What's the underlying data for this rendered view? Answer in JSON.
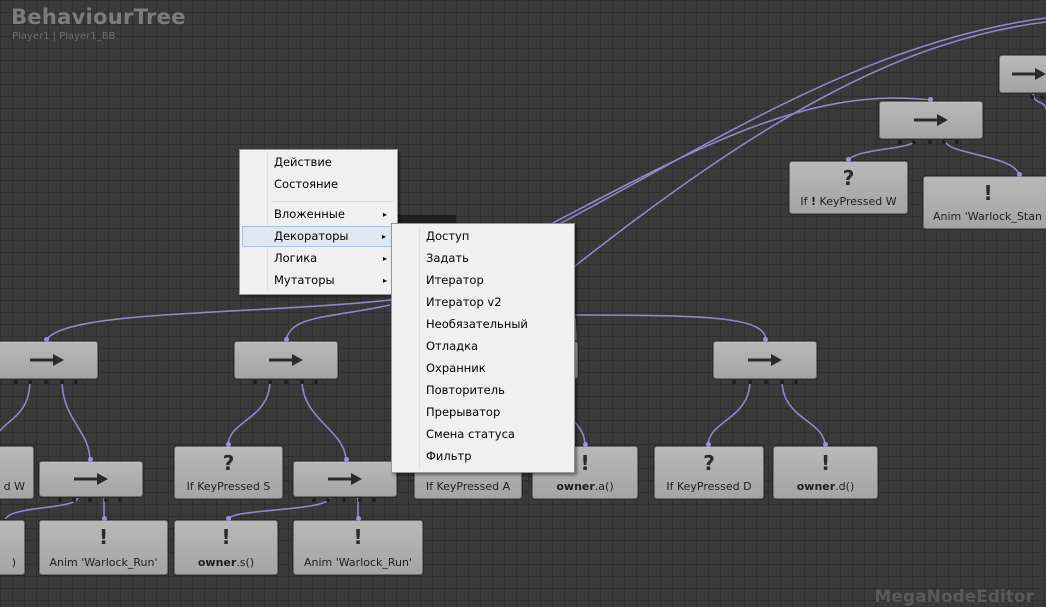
{
  "header": {
    "title": "BehaviourTree",
    "subtitle": "Player1 | Player1_BB"
  },
  "watermark": "MegaNodeEditor",
  "colors": {
    "wire": "#8f87c9",
    "node": "#adadad",
    "background": "#3a3a3a"
  },
  "nodes": {
    "seq_top_right": {
      "icon": "arrow-right-icon"
    },
    "seq_right": {
      "icon": "arrow-right-icon"
    },
    "if_w_right": {
      "glyph": "?",
      "label_prefix": "If ",
      "label_bang": "!",
      "label_rest": " KeyPressed W"
    },
    "anim_stand": {
      "glyph": "!",
      "label": "Anim 'Warlock_Stan"
    },
    "seq_1": {
      "icon": "arrow-right-icon"
    },
    "seq_2": {
      "icon": "arrow-right-icon"
    },
    "seq_4": {
      "icon": "arrow-right-icon"
    },
    "seq_run_left": {
      "icon": "arrow-right-icon"
    },
    "seq_run_mid": {
      "icon": "arrow-right-icon"
    },
    "left_w": {
      "label": "d W"
    },
    "left_paren": {
      "label": ")"
    },
    "anim_run_left": {
      "glyph": "!",
      "label": "Anim 'Warlock_Run'"
    },
    "if_s": {
      "glyph": "?",
      "label": "If KeyPressed S"
    },
    "owner_s": {
      "glyph": "!",
      "label_bold": "owner",
      "label_rest": ".s()"
    },
    "anim_run_mid": {
      "glyph": "!",
      "label": "Anim 'Warlock_Run'"
    },
    "if_a": {
      "label": "If KeyPressed A"
    },
    "owner_a": {
      "glyph": "!",
      "label_bold": "owner",
      "label_rest": ".a()"
    },
    "if_d": {
      "glyph": "?",
      "label": "If KeyPressed D"
    },
    "owner_d": {
      "glyph": "!",
      "label_bold": "owner",
      "label_rest": ".d()"
    }
  },
  "context_menu": {
    "items": [
      {
        "label": "Действие",
        "submenu": false
      },
      {
        "label": "Состояние",
        "submenu": false
      },
      {
        "label": "Вложенные",
        "submenu": true
      },
      {
        "label": "Декораторы",
        "submenu": true,
        "highlighted": true
      },
      {
        "label": "Логика",
        "submenu": true
      },
      {
        "label": "Мутаторы",
        "submenu": true
      }
    ],
    "submenu_arrow": "▸"
  },
  "submenu": {
    "items": [
      "Доступ",
      "Задать",
      "Итератор",
      "Итератор v2",
      "Необязательный",
      "Отладка",
      "Охранник",
      "Повторитель",
      "Прерыватор",
      "Смена статуса",
      "Фильтр"
    ]
  }
}
